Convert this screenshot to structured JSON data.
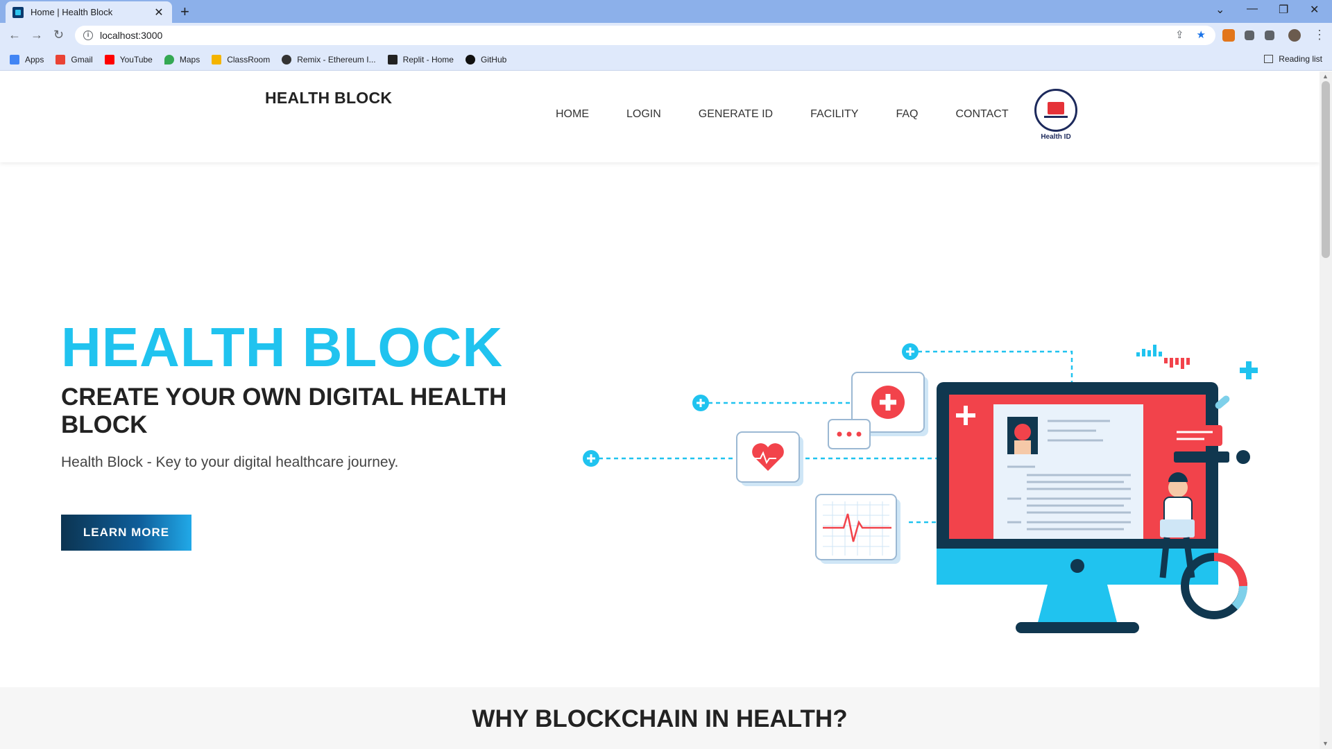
{
  "browser": {
    "tab_title": "Home | Health Block",
    "tab_close": "✕",
    "new_tab": "+",
    "url": "localhost:3000",
    "bookmarks": [
      {
        "label": "Apps",
        "color": "#4285f4"
      },
      {
        "label": "Gmail",
        "color": "#ea4335"
      },
      {
        "label": "YouTube",
        "color": "#ff0000"
      },
      {
        "label": "Maps",
        "color": "#34a853"
      },
      {
        "label": "ClassRoom",
        "color": "#f4b400"
      },
      {
        "label": "Remix - Ethereum I...",
        "color": "#333333"
      },
      {
        "label": "Replit - Home",
        "color": "#222222"
      },
      {
        "label": "GitHub",
        "color": "#111111"
      }
    ],
    "reading_list": "Reading list"
  },
  "header": {
    "brand": "HEALTH BLOCK",
    "menu": [
      "HOME",
      "LOGIN",
      "GENERATE ID",
      "FACILITY",
      "FAQ",
      "CONTACT"
    ],
    "logo_text": "Health ID"
  },
  "hero": {
    "title": "HEALTH BLOCK",
    "subtitle": "CREATE YOUR OWN DIGITAL HEALTH BLOCK",
    "tagline": "Health Block - Key to your digital healthcare journey.",
    "button": "LEARN MORE"
  },
  "why": {
    "title": "WHY BLOCKCHAIN IN HEALTH?"
  },
  "colors": {
    "accent": "#20c3ef",
    "dark_navy": "#0c3451",
    "red": "#f2434b"
  }
}
